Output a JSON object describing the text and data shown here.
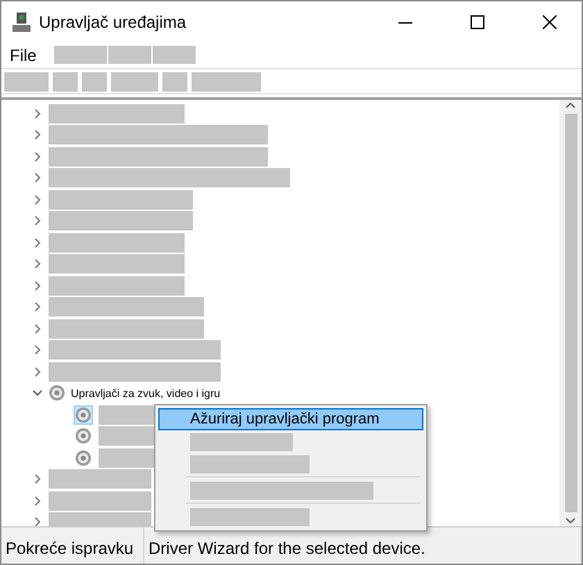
{
  "window": {
    "title": "Upravljač uređajima"
  },
  "menu": [
    {
      "label": "File"
    },
    {
      "kind": "redacted"
    },
    {
      "kind": "redacted"
    },
    {
      "kind": "redacted"
    }
  ],
  "toolbar": [
    {
      "kind": "redacted"
    },
    {
      "kind": "redacted"
    },
    {
      "kind": "redacted"
    },
    {
      "kind": "redacted"
    },
    {
      "kind": "redacted"
    },
    {
      "kind": "redacted"
    }
  ],
  "tree": [
    {
      "kind": "redacted",
      "expanded": false
    },
    {
      "kind": "redacted",
      "expanded": false
    },
    {
      "kind": "redacted",
      "expanded": false
    },
    {
      "kind": "redacted",
      "expanded": false
    },
    {
      "kind": "redacted",
      "expanded": false
    },
    {
      "kind": "redacted",
      "expanded": false
    },
    {
      "kind": "redacted",
      "expanded": false
    },
    {
      "kind": "redacted",
      "expanded": false
    },
    {
      "kind": "redacted",
      "expanded": false
    },
    {
      "kind": "redacted",
      "expanded": false
    },
    {
      "kind": "redacted",
      "expanded": false
    },
    {
      "kind": "redacted",
      "expanded": false
    },
    {
      "kind": "redacted",
      "expanded": false
    },
    {
      "label": "Upravljači za zvuk, video i igru",
      "expanded": true,
      "children": [
        {
          "kind": "redacted",
          "selected": true
        },
        {
          "kind": "redacted",
          "selected": false
        },
        {
          "kind": "redacted",
          "selected": false
        }
      ]
    },
    {
      "kind": "redacted",
      "expanded": false
    },
    {
      "kind": "redacted",
      "expanded": false
    },
    {
      "kind": "redacted",
      "expanded": false
    }
  ],
  "context_menu": [
    {
      "label": "Ažuriraj upravljački program",
      "selected": true
    },
    {
      "kind": "redacted",
      "selected": false
    },
    {
      "kind": "redacted",
      "selected": false
    },
    {
      "kind": "separator"
    },
    {
      "kind": "redacted",
      "selected": false
    },
    {
      "kind": "separator"
    },
    {
      "kind": "redacted",
      "selected": false
    }
  ],
  "status_bar": [
    {
      "text": "Pokreće ispravku"
    },
    {
      "text": "Driver Wizard for the selected device."
    }
  ]
}
